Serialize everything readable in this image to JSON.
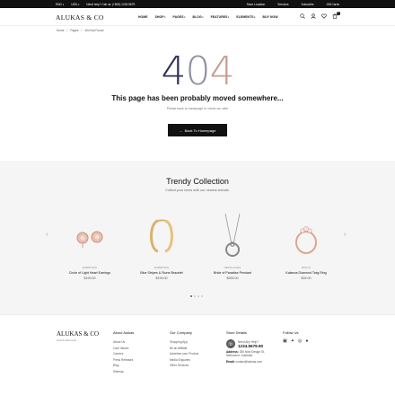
{
  "topbar": {
    "currency": "ENG",
    "lang": "USD",
    "help": "Need help? Call us: (+800) 1234 5679",
    "links": [
      "Store Location",
      "Services",
      "Subscribe",
      "Gift Cards"
    ]
  },
  "header": {
    "logo": "ALUKAS & CO",
    "nav": [
      "HOME",
      "SHOP",
      "PAGES",
      "BLOG",
      "FEATURES",
      "ELEMENTS",
      "BUY NOW"
    ],
    "cart_count": "0",
    "icons": [
      "search-icon",
      "user-icon",
      "heart-icon",
      "cart-icon"
    ]
  },
  "breadcrumb": {
    "home": "Home",
    "sep": "/",
    "pages": "Pages",
    "current": "404 Not Found"
  },
  "error": {
    "d1": "4",
    "d2": "0",
    "d3": "4",
    "title": "This page has been probably moved somewhere...",
    "subtitle": "Please back to homepage or check our offer",
    "button": "Back To Homepage"
  },
  "trendy": {
    "title": "Trendy Collection",
    "subtitle": "Collect your loves with our newest arrivals.",
    "products": [
      {
        "category": "EARRINGS",
        "name": "Circle of Light Heart Earrings",
        "price": "$199.00"
      },
      {
        "category": "EARRINGS",
        "name": "Blue Stripes & Stone Bracelet",
        "price": "$199.00"
      },
      {
        "category": "NECKLACES",
        "name": "Bride of Paradise Pendant",
        "price": "$399.00"
      },
      {
        "category": "RINGS",
        "name": "Kalanna Diamond Twig Ring",
        "price": "$39.00"
      }
    ]
  },
  "footer": {
    "logo": "ALUKAS & CO",
    "tagline": "Gold & Diamonds",
    "about": {
      "title": "About Alukas",
      "links": [
        "About Us",
        "Care Values",
        "Careers",
        "Press Releases",
        "Blog",
        "Sitemap"
      ]
    },
    "company": {
      "title": "Our Company",
      "links": [
        "Shopping App",
        "Be an Affiliate",
        "Advertise your Product",
        "Media Enquiries",
        "Other Services"
      ]
    },
    "store": {
      "title": "Store Details",
      "need": "Need Any Help?",
      "phone": "1234.5679.90",
      "address_label": "Address:",
      "address": "350 New Design St, Melbourne, Australia",
      "email_label": "Email:",
      "email": "contact@alukas.com"
    },
    "follow": {
      "title": "Follow Us"
    }
  }
}
